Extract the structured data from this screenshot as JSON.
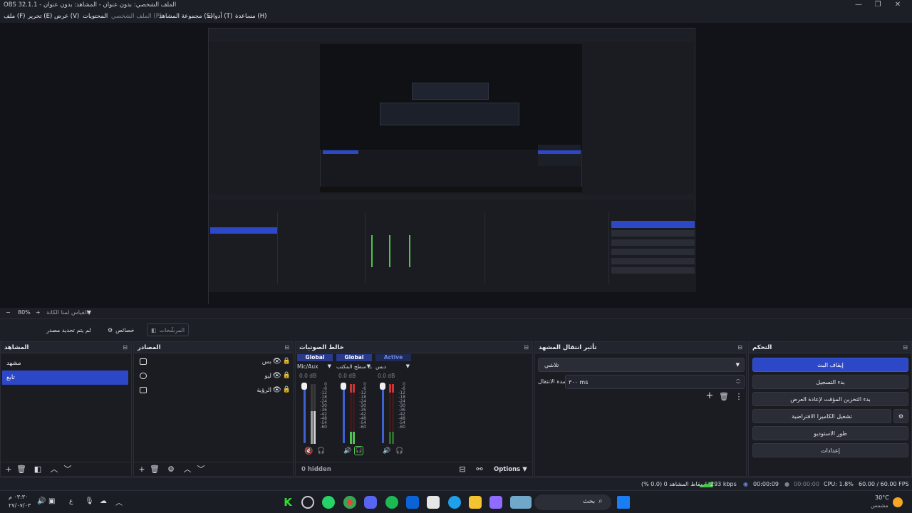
{
  "titlebar": {
    "title": "OBS 32.1.1 - الملف الشخصي: بدون عنوان - المشاهد: بدون عنوان",
    "minimize": "—",
    "maximize": "❐",
    "close": "✕"
  },
  "menu": [
    "ملف (F)",
    "تحرير (E)",
    "عرض (V)",
    "المحتويات",
    "الملف الشخصي (P)",
    "مجموعة المشاهد (S)",
    "أدوات (T)",
    "مساعدة (H)"
  ],
  "zoom": {
    "minus": "−",
    "value": "80%",
    "plus": "+",
    "fit_label": "القياس لمنا الكانة"
  },
  "context_bar": {
    "no_source": "لم يتم تحديد مصدر",
    "properties": "خصائص",
    "filters": "المرشّحات"
  },
  "scenes": {
    "title": "المشاهد",
    "items": [
      {
        "label": "مشهد",
        "selected": false
      },
      {
        "label": "تابع",
        "selected": true
      }
    ]
  },
  "sources": {
    "title": "المصادر",
    "items": [
      {
        "label": "بس",
        "icon": "browser-icon"
      },
      {
        "label": "ليو",
        "icon": "gamepad-icon"
      },
      {
        "label": "الرؤية",
        "icon": "display-icon"
      }
    ]
  },
  "mixer": {
    "title": "خالط الصوتيات",
    "channels": [
      {
        "bus": "Global",
        "name": "Mic/Aux",
        "db": "0.0 dB",
        "muted": true,
        "level": 0.55
      },
      {
        "bus": "Global",
        "name": "صوت سطح المكتب",
        "db": "0.0 dB",
        "muted": false,
        "level": 0.28
      },
      {
        "bus": "Active",
        "name": "دبس",
        "db": "0.0 dB",
        "muted": false,
        "level": 0.0
      }
    ],
    "scale": [
      "0",
      "-6",
      "-12",
      "-18",
      "-24",
      "-30",
      "-36",
      "-42",
      "-48",
      "-54",
      "-60"
    ],
    "hidden": "0 hidden",
    "options": "Options"
  },
  "transitions": {
    "title": "تأثير انتقال المشهد",
    "selected": "تلاشي",
    "duration_label": "مدة الانتقال",
    "duration_value": "٣٠٠ ms"
  },
  "controls": {
    "title": "التحكم",
    "buttons": [
      "إيقاف البث",
      "بدء التسجيل",
      "بدء التخزين المؤقت لإعادة العرض",
      "تشغيل الكاميرا الافتراضية",
      "طور الاستوديو",
      "إعدادات"
    ]
  },
  "status": {
    "dropped": "إسقاط المشاهد 0 (0.0 %)",
    "kbps": "293 kbps",
    "live_time": "00:00:09",
    "rec_time": "00:00:00",
    "cpu": "CPU: 1.8%",
    "fps": "60.00 / 60.00 FPS"
  },
  "taskbar": {
    "time": "٠٣:٣٠ م",
    "date": "٢٧/٠٧/٠٣",
    "search": "بحث",
    "weather_temp": "30°C",
    "weather_label": "مشمس",
    "lang": "ع"
  },
  "colors": {
    "accent": "#2d48c7",
    "panel": "#1a1c22",
    "bg": "#1d1f26"
  }
}
